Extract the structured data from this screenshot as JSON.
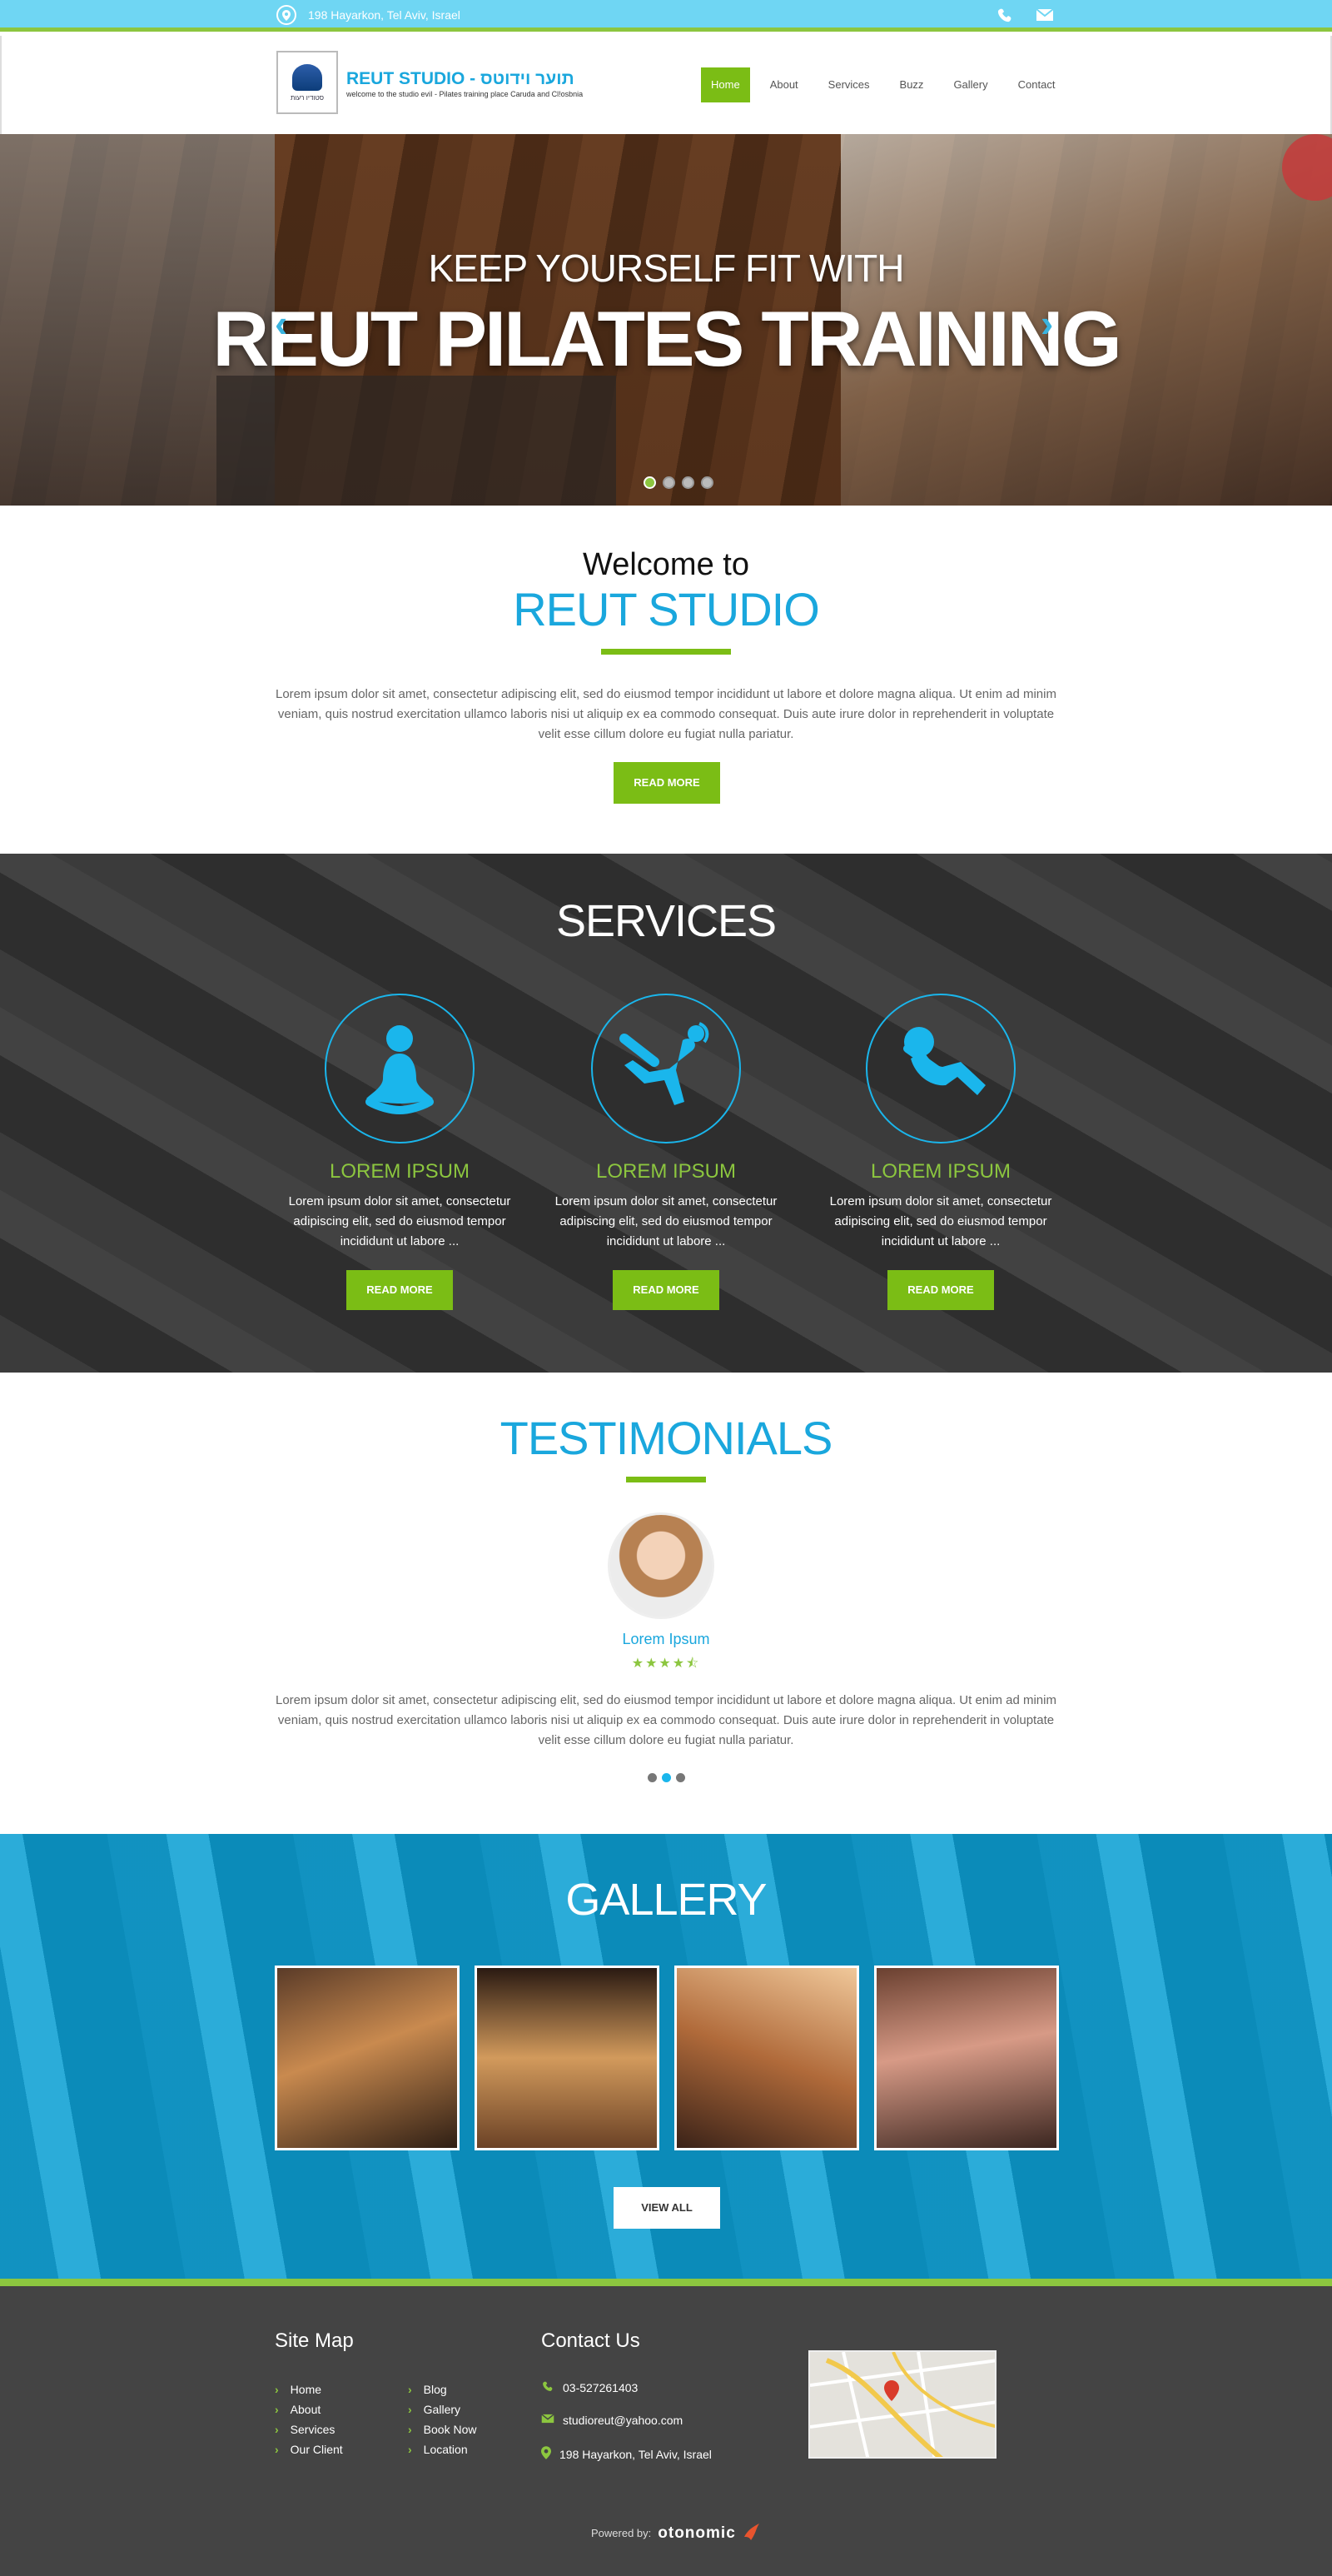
{
  "topbar": {
    "address": "198 Hayarkon, Tel Aviv, Israel",
    "icons": [
      "map-pin-icon",
      "phone-icon",
      "mail-icon"
    ]
  },
  "header": {
    "brand_name": "REUT STUDIO - תוער וידוטס",
    "tagline": "welcome to the studio eviI - Pilates training place Caruda and Cl!osbnia",
    "logo_caption": "סטודיו רעות"
  },
  "nav": {
    "items": [
      "Home",
      "About",
      "Services",
      "Buzz",
      "Gallery",
      "Contact"
    ],
    "active": "Home"
  },
  "hero": {
    "line1": "KEEP YOURSELF FIT WITH",
    "line2": "REUT PILATES TRAINING",
    "slides": 4,
    "active_slide": 1
  },
  "welcome": {
    "pre": "Welcome to",
    "title": "REUT STUDIO",
    "text": "Lorem ipsum dolor sit amet, consectetur adipiscing elit, sed do eiusmod tempor incididunt ut labore et dolore magna aliqua. Ut enim ad minim veniam, quis nostrud exercitation ullamco laboris nisi ut aliquip ex ea commodo consequat. Duis aute irure dolor in reprehenderit in voluptate velit esse cillum dolore eu fugiat nulla pariatur.",
    "button": "READ MORE"
  },
  "services": {
    "title": "SERVICES",
    "items": [
      {
        "title": "LOREM IPSUM",
        "text": "Lorem ipsum dolor sit amet, consectetur adipiscing elit, sed do eiusmod tempor incididunt ut labore ...",
        "button": "READ MORE",
        "icon": "meditation-icon"
      },
      {
        "title": "LOREM IPSUM",
        "text": "Lorem ipsum dolor sit amet, consectetur adipiscing elit, sed do eiusmod tempor incididunt ut labore ...",
        "button": "READ MORE",
        "icon": "exercise-icon"
      },
      {
        "title": "LOREM IPSUM",
        "text": "Lorem ipsum dolor sit amet, consectetur adipiscing elit, sed do eiusmod tempor incididunt ut labore ...",
        "button": "READ MORE",
        "icon": "situp-icon"
      }
    ]
  },
  "testimonials": {
    "title": "TESTIMONIALS",
    "name": "Lorem Ipsum",
    "rating": 4.5,
    "stars": "★★★★⯪",
    "text": "Lorem ipsum dolor sit amet, consectetur adipiscing elit, sed do eiusmod tempor incididunt ut labore et dolore magna aliqua. Ut enim ad minim veniam, quis nostrud exercitation ullamco laboris nisi ut aliquip ex ea commodo consequat. Duis aute irure dolor in reprehenderit in voluptate velit esse cillum dolore eu fugiat nulla pariatur.",
    "slides": 3,
    "active_slide": 2
  },
  "gallery": {
    "title": "GALLERY",
    "button": "VIEW ALL",
    "thumb_count": 4
  },
  "footer": {
    "sitemap_title": "Site Map",
    "sitemap_col1": [
      "Home",
      "About",
      "Services",
      "Our Client"
    ],
    "sitemap_col2": [
      "Blog",
      "Gallery",
      "Book Now",
      "Location"
    ],
    "contact_title": "Contact Us",
    "phone": "03-527261403",
    "email": "studioreut@yahoo.com",
    "address": "198 Hayarkon, Tel Aviv, Israel",
    "powered_label": "Powered by:",
    "powered_brand": "otonomic"
  },
  "colors": {
    "accent_green": "#7bbd15",
    "accent_blue": "#1aa7dd",
    "topbar": "#6fd6f3",
    "footer": "#444444"
  }
}
